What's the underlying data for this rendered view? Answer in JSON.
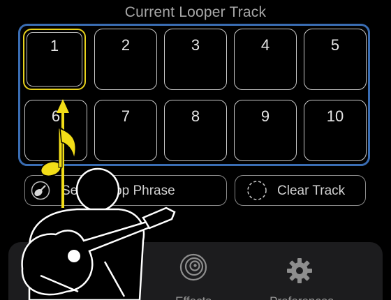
{
  "header": {
    "title": "Current Looper Track"
  },
  "tracks": [
    {
      "number": "1"
    },
    {
      "number": "2"
    },
    {
      "number": "3"
    },
    {
      "number": "4"
    },
    {
      "number": "5"
    },
    {
      "number": "6"
    },
    {
      "number": "7"
    },
    {
      "number": "8"
    },
    {
      "number": "9"
    },
    {
      "number": "10"
    }
  ],
  "selected_track": "1",
  "actions": {
    "loop_phrase_label": "Se    no Loop Phrase",
    "clear_track_label": "Clear Track"
  },
  "tabbar": {
    "effects_label": "Effects",
    "preferences_label": "Preferences"
  },
  "colors": {
    "accent_frame": "#3a6db3",
    "selected_pad": "#e8d21c",
    "tutorial_overlay": "#f2dd18"
  },
  "icons": {
    "loop_phrase": "guitar-badge-icon",
    "clear_track": "dashed-circle-icon",
    "effects": "effects-swirl-icon",
    "preferences": "gear-icon",
    "overlay_note": "music-note-icon",
    "overlay_person": "guitarist-icon"
  }
}
